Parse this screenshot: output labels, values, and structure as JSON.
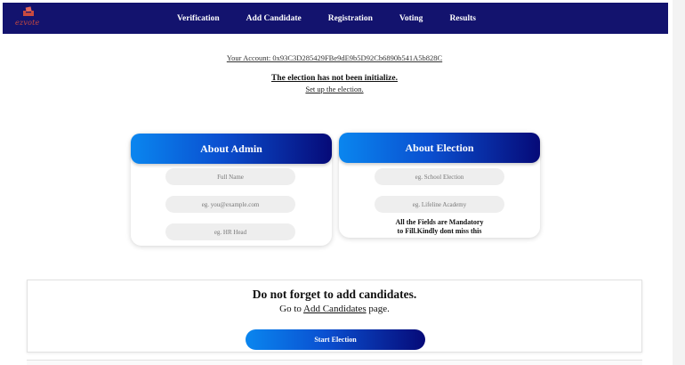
{
  "brand": {
    "text": "ezvote",
    "icon": "ballot-logo-icon",
    "color": "#c94a3f"
  },
  "nav": {
    "background": "#13136e",
    "items": [
      {
        "label": "Verification"
      },
      {
        "label": "Add Candidate"
      },
      {
        "label": "Registration"
      },
      {
        "label": "Voting"
      },
      {
        "label": "Results"
      }
    ]
  },
  "account": {
    "text": "Your Account: 0x93C3D285429FBe9dE9b5D92Cb6890b541A5b828C"
  },
  "status": {
    "title": "The election has not been initialize.",
    "setup_link": "Set up the election."
  },
  "admin_card": {
    "title": "About Admin",
    "fields": [
      {
        "placeholder": "Full Name"
      },
      {
        "placeholder": "eg. you@example.com"
      },
      {
        "placeholder": "eg. HR Head"
      }
    ]
  },
  "election_card": {
    "title": "About Election",
    "fields": [
      {
        "placeholder": "eg. School Election"
      },
      {
        "placeholder": "eg. Lifeline Academy"
      }
    ],
    "note_line1": "All the Fields are Mandatory",
    "note_line2": "to Fill.Kindly dont miss this"
  },
  "reminder": {
    "title": "Do not forget to add candidates.",
    "prefix": "Go to",
    "link": "Add Candidates",
    "suffix": "page.",
    "button": "Start Election"
  },
  "colors": {
    "gradient_start": "#0a86ef",
    "gradient_end": "#060a78",
    "field_bg": "#eeeeee"
  }
}
